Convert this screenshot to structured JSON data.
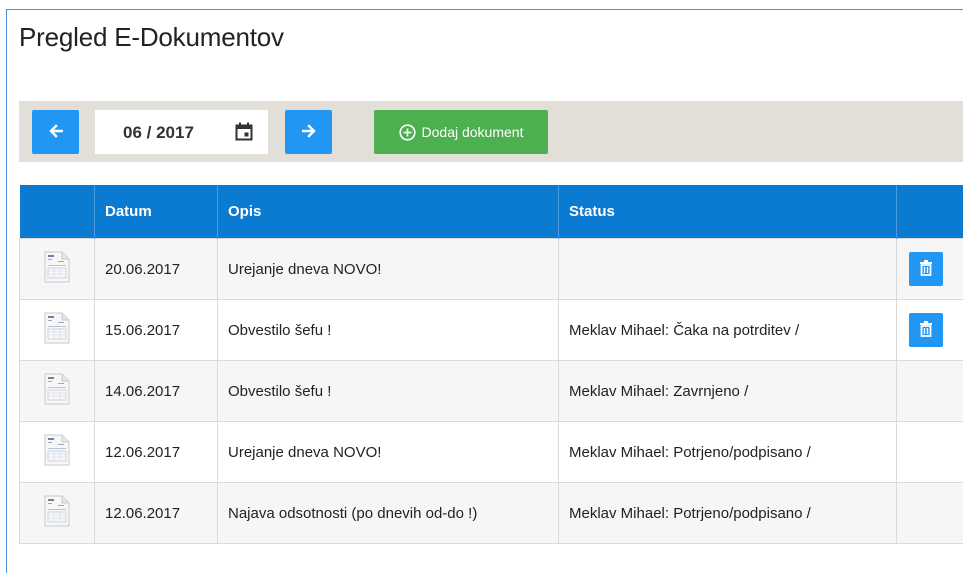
{
  "page": {
    "title": "Pregled E-Dokumentov"
  },
  "toolbar": {
    "prev_icon": "arrow-left-icon",
    "date_value": "06 / 2017",
    "calendar_icon": "calendar-icon",
    "next_icon": "arrow-right-icon",
    "add_label": "Dodaj dokument",
    "add_icon": "plus-circle-icon"
  },
  "colors": {
    "primary": "#2196f3",
    "header": "#0b7bd1",
    "success": "#4caf50",
    "toolbar_bg": "#e2ded8"
  },
  "table": {
    "columns": [
      "",
      "Datum",
      "Opis",
      "Status",
      ""
    ],
    "rows": [
      {
        "date": "20.06.2017",
        "description": "Urejanje dneva NOVO!",
        "status": "",
        "deletable": true
      },
      {
        "date": "15.06.2017",
        "description": "Obvestilo šefu !",
        "status": "Meklav Mihael: Čaka na potrditev /",
        "deletable": true
      },
      {
        "date": "14.06.2017",
        "description": "Obvestilo šefu !",
        "status": "Meklav Mihael: Zavrnjeno /",
        "deletable": false
      },
      {
        "date": "12.06.2017",
        "description": "Urejanje dneva NOVO!",
        "status": "Meklav Mihael: Potrjeno/podpisano /",
        "deletable": false
      },
      {
        "date": "12.06.2017",
        "description": "Najava odsotnosti (po dnevih od-do !)",
        "status": "Meklav Mihael: Potrjeno/podpisano /",
        "deletable": false
      }
    ],
    "doc_icon": "document-icon",
    "delete_icon": "trash-icon"
  }
}
